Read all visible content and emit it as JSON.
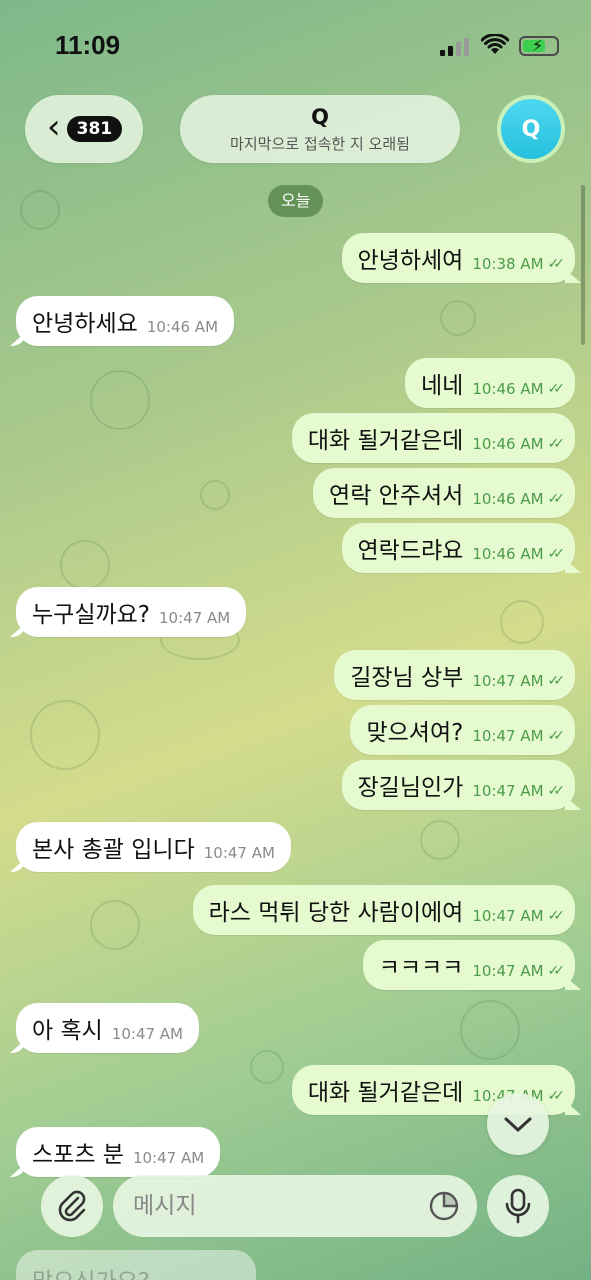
{
  "status_bar": {
    "time": "11:09"
  },
  "header": {
    "back_badge": "381",
    "chat_name": "Q",
    "chat_status": "마지막으로 접속한 지 오래됨",
    "avatar_letter": "Q",
    "avatar_color": "#2cc7e3"
  },
  "date_chip": "오늘",
  "messages": [
    {
      "dir": "out",
      "text": "안녕하세여",
      "time": "10:38 AM",
      "read": "✓✓"
    },
    {
      "dir": "in",
      "text": "안녕하세요",
      "time": "10:46 AM"
    },
    {
      "dir": "out",
      "text": "네네",
      "time": "10:46 AM",
      "read": "✓✓"
    },
    {
      "dir": "out",
      "text": "대화 될거같은데",
      "time": "10:46 AM",
      "read": "✓✓"
    },
    {
      "dir": "out",
      "text": "연락 안주셔서",
      "time": "10:46 AM",
      "read": "✓✓"
    },
    {
      "dir": "out",
      "text": "연락드랴요",
      "time": "10:46 AM",
      "read": "✓✓"
    },
    {
      "dir": "in",
      "text": "누구실까요?",
      "time": "10:47 AM"
    },
    {
      "dir": "out",
      "text": "길장님 상부",
      "time": "10:47 AM",
      "read": "✓✓"
    },
    {
      "dir": "out",
      "text": "맞으셔여?",
      "time": "10:47 AM",
      "read": "✓✓"
    },
    {
      "dir": "out",
      "text": "장길님인가",
      "time": "10:47 AM",
      "read": "✓✓"
    },
    {
      "dir": "in",
      "text": "본사 총괄 입니다",
      "time": "10:47 AM"
    },
    {
      "dir": "out",
      "text": "라스 먹튀 당한 사람이에여",
      "time": "10:47 AM",
      "read": "✓✓"
    },
    {
      "dir": "out",
      "text": "ㅋㅋㅋㅋ",
      "time": "10:47 AM",
      "read": "✓✓"
    },
    {
      "dir": "in",
      "text": "아 혹시",
      "time": "10:47 AM"
    },
    {
      "dir": "out",
      "text": "대화 될거같은데",
      "time": "10:47 AM",
      "read": "✓✓"
    },
    {
      "dir": "in",
      "text": "스포츠 분",
      "time": "10:47 AM"
    }
  ],
  "partial_message": "맞으신가요?",
  "input": {
    "placeholder": "메시지",
    "value": ""
  },
  "colors": {
    "outgoing_bubble": "#e5fbcf",
    "incoming_bubble": "#ffffff",
    "accent_green": "#4c9b4a"
  }
}
